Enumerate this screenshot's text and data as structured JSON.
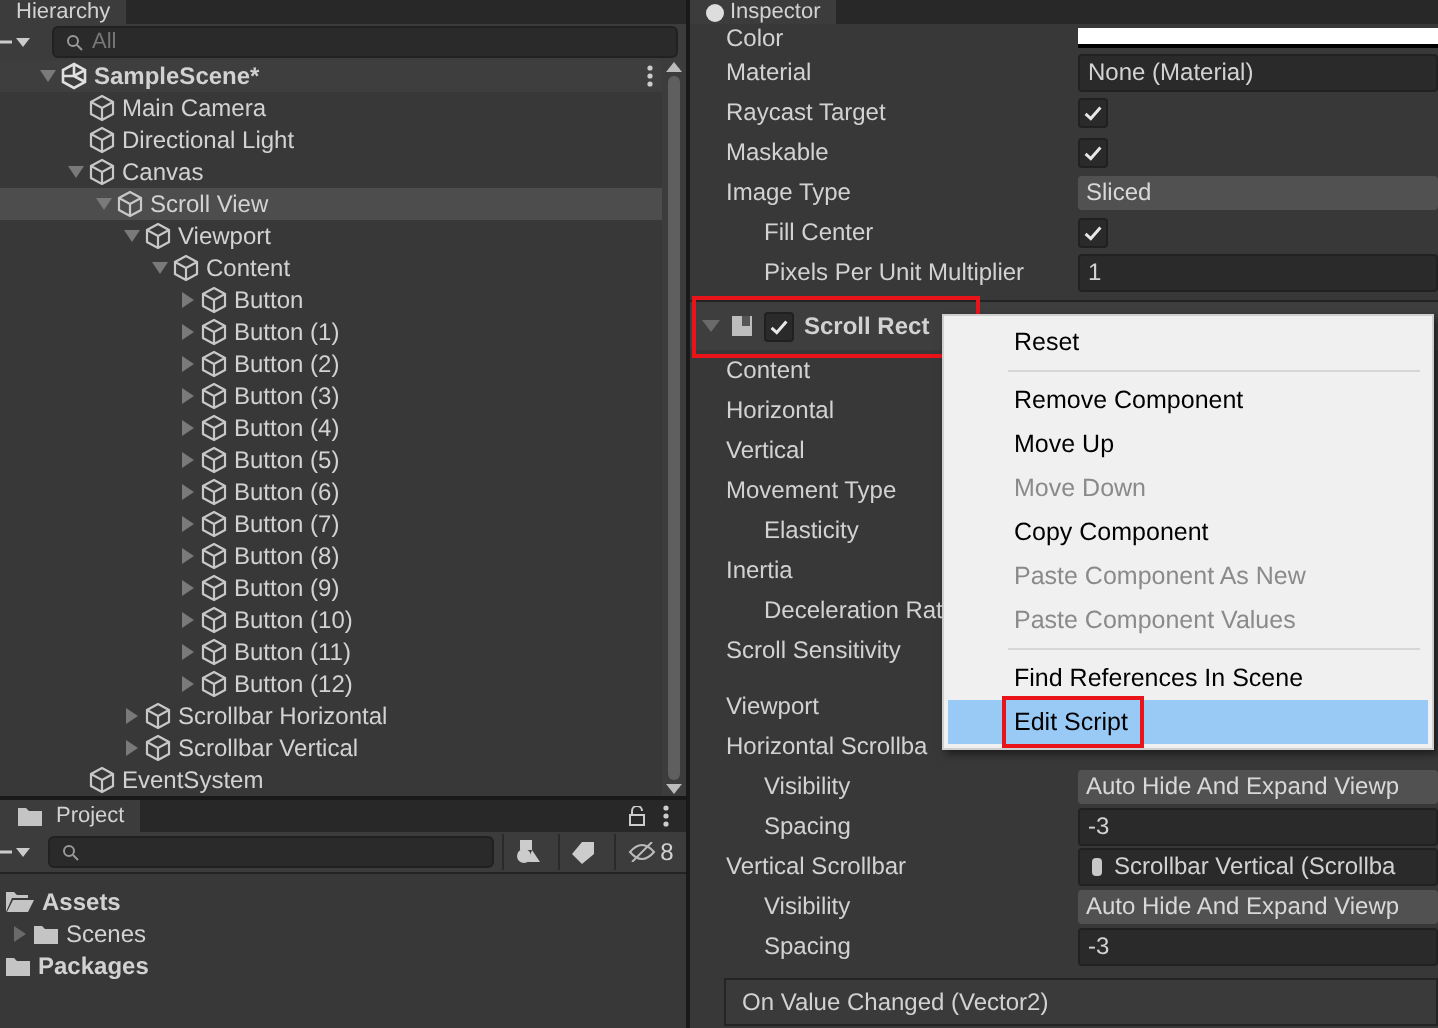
{
  "hierarchy": {
    "title": "Hierarchy",
    "search": {
      "placeholder": "All"
    },
    "tree": [
      {
        "name": "SampleScene*",
        "kind": "scene",
        "selected": false,
        "expanded": true,
        "children": [
          {
            "name": "Main Camera",
            "kind": "object",
            "selected": false
          },
          {
            "name": "Directional Light",
            "kind": "object",
            "selected": false
          },
          {
            "name": "Canvas",
            "kind": "object",
            "selected": false,
            "expanded": true,
            "children": [
              {
                "name": "Scroll View",
                "kind": "object",
                "selected": true,
                "expanded": true,
                "children": [
                  {
                    "name": "Viewport",
                    "kind": "object",
                    "selected": false,
                    "expanded": true,
                    "children": [
                      {
                        "name": "Content",
                        "kind": "object",
                        "selected": false,
                        "expanded": true,
                        "children": [
                          {
                            "name": "Button",
                            "kind": "object",
                            "selected": false,
                            "expanded": false,
                            "has_children": true
                          },
                          {
                            "name": "Button (1)",
                            "kind": "object",
                            "selected": false,
                            "expanded": false,
                            "has_children": true
                          },
                          {
                            "name": "Button (2)",
                            "kind": "object",
                            "selected": false,
                            "expanded": false,
                            "has_children": true
                          },
                          {
                            "name": "Button (3)",
                            "kind": "object",
                            "selected": false,
                            "expanded": false,
                            "has_children": true
                          },
                          {
                            "name": "Button (4)",
                            "kind": "object",
                            "selected": false,
                            "expanded": false,
                            "has_children": true
                          },
                          {
                            "name": "Button (5)",
                            "kind": "object",
                            "selected": false,
                            "expanded": false,
                            "has_children": true
                          },
                          {
                            "name": "Button (6)",
                            "kind": "object",
                            "selected": false,
                            "expanded": false,
                            "has_children": true
                          },
                          {
                            "name": "Button (7)",
                            "kind": "object",
                            "selected": false,
                            "expanded": false,
                            "has_children": true
                          },
                          {
                            "name": "Button (8)",
                            "kind": "object",
                            "selected": false,
                            "expanded": false,
                            "has_children": true
                          },
                          {
                            "name": "Button (9)",
                            "kind": "object",
                            "selected": false,
                            "expanded": false,
                            "has_children": true
                          },
                          {
                            "name": "Button (10)",
                            "kind": "object",
                            "selected": false,
                            "expanded": false,
                            "has_children": true
                          },
                          {
                            "name": "Button (11)",
                            "kind": "object",
                            "selected": false,
                            "expanded": false,
                            "has_children": true
                          },
                          {
                            "name": "Button (12)",
                            "kind": "object",
                            "selected": false,
                            "expanded": false,
                            "has_children": true
                          }
                        ]
                      }
                    ]
                  },
                  {
                    "name": "Scrollbar Horizontal",
                    "kind": "object",
                    "selected": false,
                    "expanded": false,
                    "has_children": true
                  },
                  {
                    "name": "Scrollbar Vertical",
                    "kind": "object",
                    "selected": false,
                    "expanded": false,
                    "has_children": true
                  }
                ]
              }
            ]
          },
          {
            "name": "EventSystem",
            "kind": "object",
            "selected": false
          }
        ]
      }
    ]
  },
  "project": {
    "title": "Project",
    "hidden_count": "8",
    "tree": [
      {
        "name": "Assets",
        "kind": "root",
        "expanded": true,
        "children": [
          {
            "name": "Scenes",
            "kind": "folder",
            "expanded": false
          }
        ]
      },
      {
        "name": "Packages",
        "kind": "root",
        "expanded": false
      }
    ]
  },
  "inspector": {
    "title": "Inspector",
    "rows": [
      {
        "label": "Color",
        "kind": "color"
      },
      {
        "label": "Material",
        "kind": "object",
        "value": "None (Material)"
      },
      {
        "label": "Raycast Target",
        "kind": "checkbox",
        "checked": true
      },
      {
        "label": "Maskable",
        "kind": "checkbox",
        "checked": true
      },
      {
        "label": "Image Type",
        "kind": "dropdown",
        "value": "Sliced",
        "children": [
          {
            "label": "Fill Center",
            "kind": "checkbox",
            "checked": true
          },
          {
            "label": "Pixels Per Unit Multiplier",
            "kind": "field",
            "value": "1"
          }
        ]
      }
    ],
    "component": {
      "title": "Scroll Rect",
      "enabled": true,
      "annotated": true,
      "rows": [
        {
          "label": "Content",
          "kind": "hidden"
        },
        {
          "label": "Horizontal",
          "kind": "hidden"
        },
        {
          "label": "Vertical",
          "kind": "hidden"
        },
        {
          "label": "Movement Type",
          "kind": "hidden",
          "children": [
            {
              "label": "Elasticity",
              "kind": "hidden"
            }
          ]
        },
        {
          "label": "Inertia",
          "kind": "hidden",
          "children": [
            {
              "label": "Deceleration Rat",
              "kind": "hidden"
            }
          ]
        },
        {
          "label": "Scroll Sensitivity",
          "kind": "hidden"
        },
        {
          "label": "Viewport",
          "kind": "hidden",
          "space_before": true
        },
        {
          "label": "Horizontal Scrollba",
          "kind": "hidden",
          "children": [
            {
              "label": "Visibility",
              "kind": "dropdown",
              "value": "Auto Hide And Expand Viewp"
            },
            {
              "label": "Spacing",
              "kind": "field",
              "value": "-3"
            }
          ]
        },
        {
          "label": "Vertical Scrollbar",
          "kind": "object",
          "value": "Scrollbar Vertical (Scrollba",
          "children": [
            {
              "label": "Visibility",
              "kind": "dropdown",
              "value": "Auto Hide And Expand Viewp"
            },
            {
              "label": "Spacing",
              "kind": "field",
              "value": "-3"
            }
          ]
        }
      ],
      "event": "On Value Changed (Vector2)"
    }
  },
  "context_menu": {
    "items": [
      {
        "kind": "item",
        "label": "Reset",
        "disabled": false,
        "selected": false,
        "annotated": false
      },
      {
        "kind": "separator"
      },
      {
        "kind": "item",
        "label": "Remove Component",
        "disabled": false,
        "selected": false,
        "annotated": false
      },
      {
        "kind": "item",
        "label": "Move Up",
        "disabled": false,
        "selected": false,
        "annotated": false
      },
      {
        "kind": "item",
        "label": "Move Down",
        "disabled": true,
        "selected": false,
        "annotated": false
      },
      {
        "kind": "item",
        "label": "Copy Component",
        "disabled": false,
        "selected": false,
        "annotated": false
      },
      {
        "kind": "item",
        "label": "Paste Component As New",
        "disabled": true,
        "selected": false,
        "annotated": false
      },
      {
        "kind": "item",
        "label": "Paste Component Values",
        "disabled": true,
        "selected": false,
        "annotated": false
      },
      {
        "kind": "separator"
      },
      {
        "kind": "item",
        "label": "Find References In Scene",
        "disabled": false,
        "selected": false,
        "annotated": false
      },
      {
        "kind": "item",
        "label": "Edit Script",
        "disabled": false,
        "selected": true,
        "annotated": true
      }
    ]
  }
}
